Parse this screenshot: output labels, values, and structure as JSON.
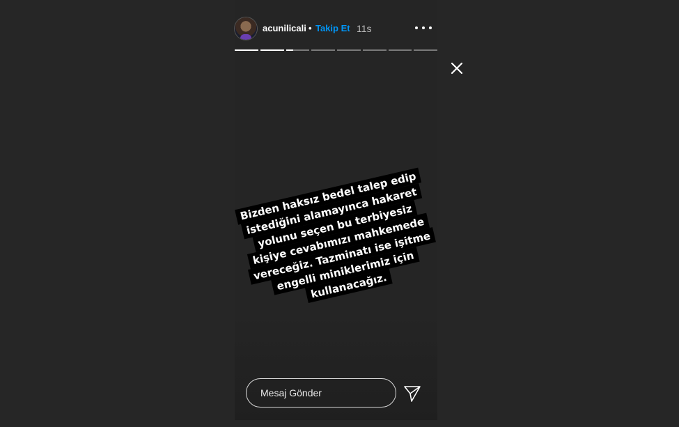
{
  "header": {
    "username": "acunilicali",
    "separator": "•",
    "follow_label": "Takip Et",
    "time": "11s"
  },
  "progress": {
    "segments": [
      1,
      1,
      0.3,
      0,
      0,
      0,
      0,
      0
    ]
  },
  "story": {
    "text_lines": [
      "Bizden haksız bedel talep edip",
      "istediğini alamayınca hakaret",
      "yolunu seçen bu terbiyesiz",
      "kişiye cevabımızı mahkemede",
      "vereceğiz. Tazminatı ise işitme",
      "engelli miniklerimiz için",
      "kullanacağız."
    ]
  },
  "reply": {
    "placeholder": "Mesaj Gönder"
  },
  "icons": {
    "close": "close-icon",
    "more": "more-options-icon",
    "send": "send-icon"
  },
  "colors": {
    "background": "#262626",
    "accent": "#0095f6"
  }
}
